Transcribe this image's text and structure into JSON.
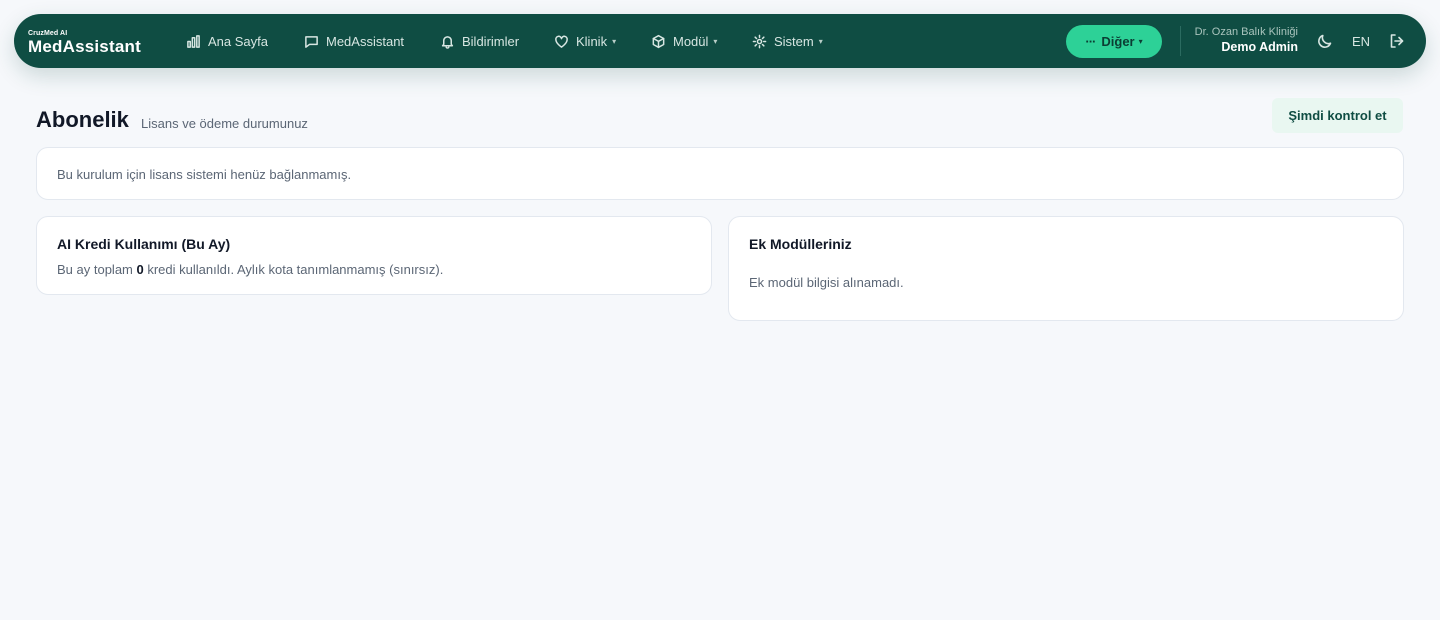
{
  "brand": {
    "small": "CruzMed AI",
    "main": "MedAssistant"
  },
  "nav": {
    "items": [
      {
        "label": "Ana Sayfa",
        "icon": "bar-chart-icon",
        "dropdown": false
      },
      {
        "label": "MedAssistant",
        "icon": "chat-icon",
        "dropdown": false
      },
      {
        "label": "Bildirimler",
        "icon": "bell-icon",
        "dropdown": false
      },
      {
        "label": "Klinik",
        "icon": "heart-icon",
        "dropdown": true
      },
      {
        "label": "Modül",
        "icon": "cube-icon",
        "dropdown": true
      },
      {
        "label": "Sistem",
        "icon": "gear-icon",
        "dropdown": true
      }
    ],
    "more_label": "Diğer",
    "caret": "▾",
    "more_dots": "···"
  },
  "user": {
    "clinic": "Dr. Ozan Balık Kliniği",
    "name": "Demo Admin"
  },
  "lang": "EN",
  "page": {
    "title": "Abonelik",
    "subtitle": "Lisans ve ödeme durumunuz",
    "check_button": "Şimdi kontrol et"
  },
  "license": {
    "message": "Bu kurulum için lisans sistemi henüz bağlanmamış."
  },
  "credit": {
    "title": "AI Kredi Kullanımı (Bu Ay)",
    "text_before": "Bu ay toplam ",
    "count": "0",
    "text_after": " kredi kullanıldı. Aylık kota tanımlanmamış (sınırsız)."
  },
  "modules": {
    "title": "Ek Modülleriniz",
    "message": "Ek modül bilgisi alınamadı."
  },
  "colors": {
    "nav_bg": "#0f4d43",
    "accent": "#2dd197",
    "page_bg": "#f6f8fb"
  }
}
